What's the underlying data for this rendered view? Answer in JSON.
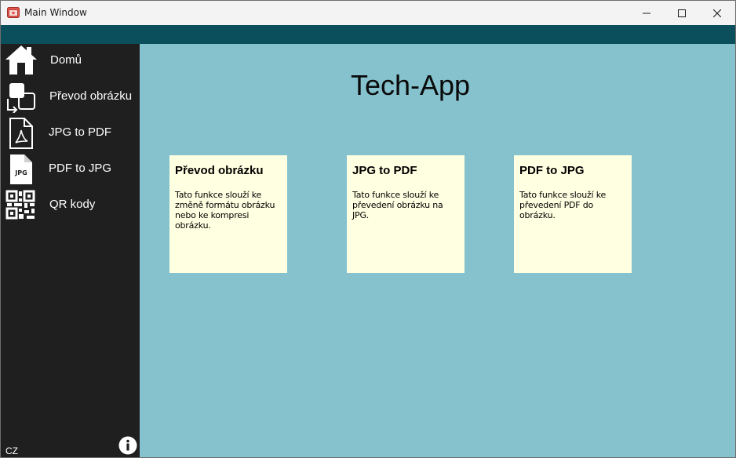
{
  "window": {
    "title": "Main Window"
  },
  "colors": {
    "topband": "#0b4f5c",
    "sidebar": "#1f1f1f",
    "main_bg": "#85c2cd",
    "card_bg": "#ffffe1"
  },
  "sidebar": {
    "items": [
      {
        "label": "Domů",
        "icon": "home-icon"
      },
      {
        "label": "Převod obrázku",
        "icon": "image-convert-icon"
      },
      {
        "label": "JPG to PDF",
        "icon": "pdf-file-icon"
      },
      {
        "label": "PDF to JPG",
        "icon": "jpg-file-icon"
      },
      {
        "label": "QR kody",
        "icon": "qr-code-icon"
      }
    ],
    "language": "CZ",
    "info_icon": "info-icon"
  },
  "main": {
    "title": "Tech-App",
    "cards": [
      {
        "title": "Převod obrázku",
        "description": "Tato funkce slouží ke změně formátu obrázku nebo ke kompresi obrázku."
      },
      {
        "title": "JPG to PDF",
        "description": "Tato funkce slouží ke převedení obrázku na JPG."
      },
      {
        "title": "PDF to JPG",
        "description": "Tato funkce slouží ke převedení PDF do obrázku."
      }
    ]
  }
}
